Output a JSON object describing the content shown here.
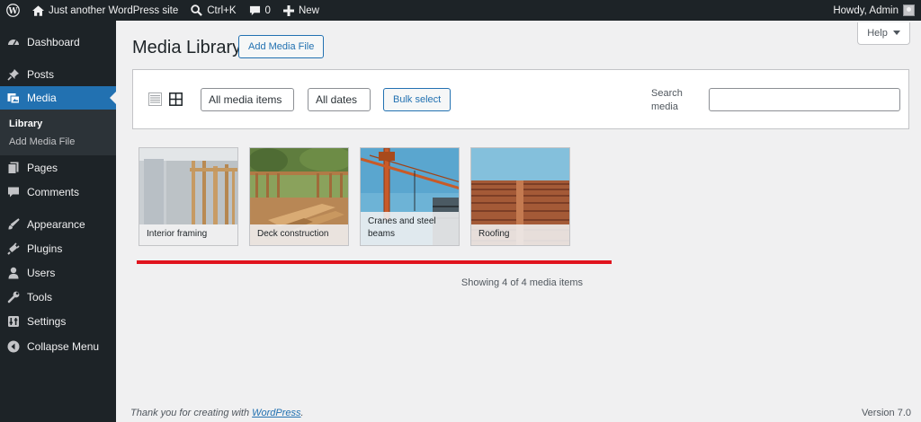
{
  "adminbar": {
    "site_name": "Just another WordPress site",
    "search_shortcut": "Ctrl+K",
    "comments_count": "0",
    "new_label": "New",
    "greeting": "Howdy, Admin"
  },
  "sidebar": {
    "items": [
      {
        "label": "Dashboard",
        "icon": "dashboard-icon"
      },
      {
        "label": "Posts",
        "icon": "pushpin-icon"
      },
      {
        "label": "Media",
        "icon": "media-icon"
      },
      {
        "label": "Pages",
        "icon": "pages-icon"
      },
      {
        "label": "Comments",
        "icon": "comment-icon"
      },
      {
        "label": "Appearance",
        "icon": "paintbrush-icon"
      },
      {
        "label": "Plugins",
        "icon": "plug-icon"
      },
      {
        "label": "Users",
        "icon": "user-icon"
      },
      {
        "label": "Tools",
        "icon": "wrench-icon"
      },
      {
        "label": "Settings",
        "icon": "settings-icon"
      },
      {
        "label": "Collapse Menu",
        "icon": "collapse-icon"
      }
    ],
    "submenu": [
      "Library",
      "Add Media File"
    ]
  },
  "header": {
    "title": "Media Library",
    "add_button": "Add Media File",
    "help_label": "Help"
  },
  "toolbar": {
    "type_filter": "All media items",
    "date_filter": "All dates",
    "bulk_select": "Bulk select",
    "search_label": "Search media",
    "search_value": ""
  },
  "media_items": [
    {
      "caption": "Interior framing"
    },
    {
      "caption": "Deck construction"
    },
    {
      "caption": "Cranes and steel beams"
    },
    {
      "caption": "Roofing"
    }
  ],
  "status": {
    "count_text": "Showing 4 of 4 media items"
  },
  "footer": {
    "thanks_prefix": "Thank you for creating with",
    "thanks_link": "WordPress",
    "thanks_suffix": ".",
    "version": "Version 7.0"
  },
  "colors": {
    "admin_bar": "#1d2327",
    "accent": "#2271b1",
    "highlight_line": "#e0141e"
  }
}
